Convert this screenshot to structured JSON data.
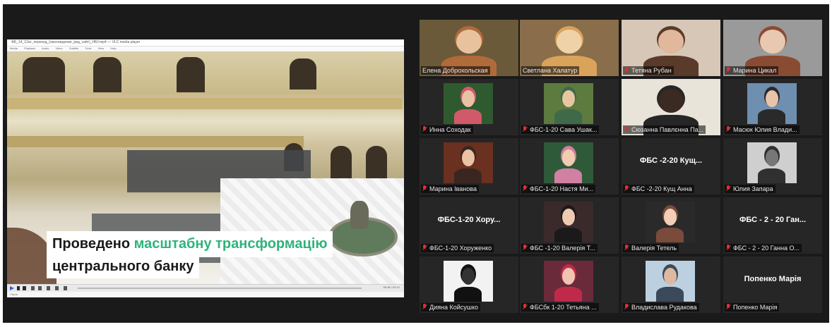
{
  "shared_screen": {
    "window_title": "ФБ_14_12ат_переход_(прохождение_ред_сайт)_НБУ.mp4 — VLC media player",
    "menu": [
      "Media",
      "Playback",
      "Audio",
      "Video",
      "Subtitle",
      "Tools",
      "View",
      "Help"
    ],
    "caption_line1_prefix": "Проведено ",
    "caption_line1_accent": "масштабну трансформацію",
    "caption_line2": "центрального банку",
    "accent_color": "#2fb37a",
    "playback_time": "00:36 / 02:12",
    "status_text": "Пауза"
  },
  "participants": [
    {
      "name": "Елена Доброхольская",
      "muted": false,
      "video": true,
      "active": false
    },
    {
      "name": "Светлана Халатур",
      "muted": false,
      "video": true,
      "active": true
    },
    {
      "name": "Тетяна Рубан",
      "muted": true,
      "video": true,
      "active": false
    },
    {
      "name": "Марина Цикал",
      "muted": true,
      "video": true,
      "active": false
    },
    {
      "name": "Инна Соходак",
      "muted": true,
      "video": true,
      "active": false
    },
    {
      "name": "ФБС-1-20 Сава Ушак...",
      "muted": true,
      "video": true,
      "active": false
    },
    {
      "name": "Сюзанна Павлєнна Па...",
      "muted": true,
      "video": true,
      "active": false
    },
    {
      "name": "Масюк Юлия Влади...",
      "muted": true,
      "video": true,
      "active": false
    },
    {
      "name": "Марина Іванова",
      "muted": true,
      "video": true,
      "active": false
    },
    {
      "name": "ФБС-1-20 Настя Ми...",
      "muted": true,
      "video": true,
      "active": false
    },
    {
      "name": "ФБС -2-20 Кущ Анна",
      "muted": true,
      "video": false,
      "big_label": "ФБС -2-20 Кущ...",
      "active": false
    },
    {
      "name": "Юлия Запара",
      "muted": true,
      "video": true,
      "active": false
    },
    {
      "name": "ФБС-1-20 Хоруженко",
      "muted": true,
      "video": false,
      "big_label": "ФБС-1-20 Хору...",
      "active": false
    },
    {
      "name": "ФБС -1-20 Валерія Т...",
      "muted": true,
      "video": true,
      "active": false
    },
    {
      "name": "Валерія Тетель",
      "muted": true,
      "video": true,
      "active": false
    },
    {
      "name": "ФБС - 2 - 20 Ганна О...",
      "muted": true,
      "video": false,
      "big_label": "ФБС - 2 - 20 Ган...",
      "active": false
    },
    {
      "name": "Дияна Койсушко",
      "muted": true,
      "video": true,
      "active": false
    },
    {
      "name": "ФБСбк 1-20 Тетьяна ...",
      "muted": true,
      "video": true,
      "active": false
    },
    {
      "name": "Владислава Рудакова",
      "muted": true,
      "video": true,
      "active": false
    },
    {
      "name": "Попенко Марія",
      "muted": true,
      "video": false,
      "big_label": "Попенко Марія",
      "active": false
    }
  ]
}
